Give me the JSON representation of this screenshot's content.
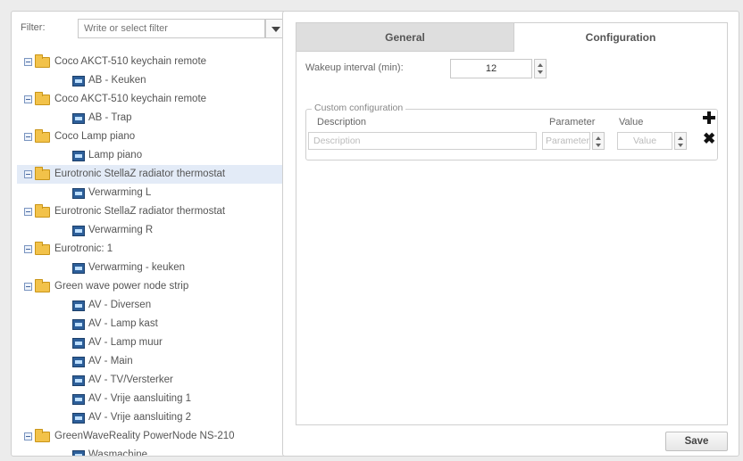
{
  "filter": {
    "label": "Filter:",
    "placeholder": "Write or select filter"
  },
  "tree": [
    {
      "label": "Coco AKCT-510 keychain remote",
      "children": [
        "AB - Keuken"
      ]
    },
    {
      "label": "Coco AKCT-510 keychain remote",
      "children": [
        "AB - Trap"
      ]
    },
    {
      "label": "Coco Lamp piano",
      "children": [
        "Lamp piano"
      ]
    },
    {
      "label": "Eurotronic StellaZ radiator thermostat",
      "selected": true,
      "children": [
        "Verwarming L"
      ]
    },
    {
      "label": "Eurotronic StellaZ radiator thermostat",
      "children": [
        "Verwarming R"
      ]
    },
    {
      "label": "Eurotronic: 1",
      "children": [
        "Verwarming - keuken"
      ]
    },
    {
      "label": "Green wave power node strip",
      "children": [
        "AV - Diversen",
        "AV - Lamp kast",
        "AV - Lamp muur",
        "AV - Main",
        "AV - TV/Versterker",
        "AV - Vrije aansluiting 1",
        "AV - Vrije aansluiting 2"
      ]
    },
    {
      "label": "GreenWaveReality PowerNode NS-210",
      "children": [
        "Wasmachine"
      ]
    }
  ],
  "tabs": {
    "general": "General",
    "configuration": "Configuration"
  },
  "config": {
    "wakeup_label": "Wakeup interval (min):",
    "wakeup_value": "12",
    "custom_legend": "Custom configuration",
    "col_description": "Description",
    "col_parameter": "Parameter",
    "col_value": "Value",
    "desc_placeholder": "Description",
    "param_placeholder": "Parameter",
    "value_placeholder": "Value"
  },
  "save_label": "Save"
}
